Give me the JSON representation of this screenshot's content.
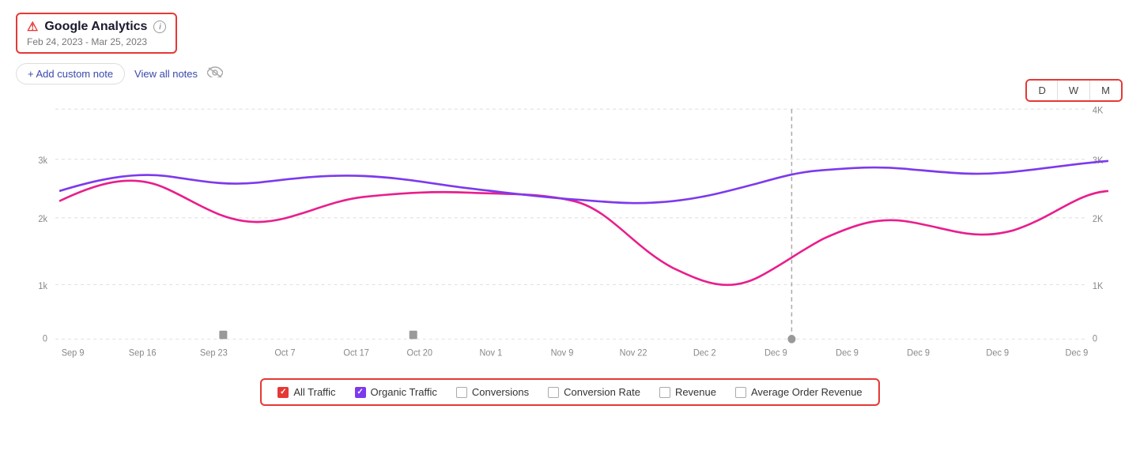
{
  "header": {
    "title": "Google Analytics",
    "date_range": "Feb 24, 2023 - Mar 25, 2023",
    "info_label": "i"
  },
  "toolbar": {
    "add_note_label": "+ Add custom note",
    "view_all_label": "View all notes"
  },
  "time_buttons": {
    "d_label": "D",
    "w_label": "W",
    "m_label": "M"
  },
  "chart": {
    "x_labels": [
      "Sep 9",
      "Sep 16",
      "Sep 23",
      "Oct 7",
      "Oct 17",
      "Oct 20",
      "Nov 1",
      "Nov 9",
      "Nov 22",
      "Dec 2",
      "Dec 9",
      "Dec 9",
      "Dec 9",
      "Dec 9",
      "Dec 9"
    ],
    "y_left_labels": [
      "0",
      "1k",
      "2k",
      "3k"
    ],
    "y_right_labels": [
      "0",
      "1K",
      "2K",
      "3K",
      "4K"
    ],
    "vertical_line_x": "Dec 9"
  },
  "legend": {
    "items": [
      {
        "label": "All Traffic",
        "checked": true,
        "color": "red"
      },
      {
        "label": "Organic Traffic",
        "checked": true,
        "color": "purple"
      },
      {
        "label": "Conversions",
        "checked": false,
        "color": "none"
      },
      {
        "label": "Conversion Rate",
        "checked": false,
        "color": "none"
      },
      {
        "label": "Revenue",
        "checked": false,
        "color": "none"
      },
      {
        "label": "Average Order Revenue",
        "checked": false,
        "color": "none"
      }
    ]
  }
}
